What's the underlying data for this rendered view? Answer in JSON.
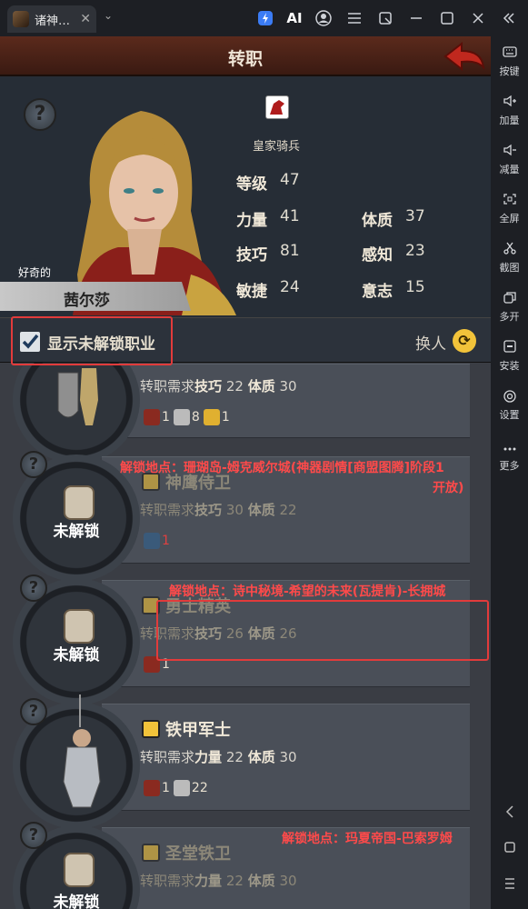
{
  "titlebar": {
    "tab_title": "诸神…",
    "tab_close": "✕",
    "dropdown": "⌄",
    "ai_label": "AI"
  },
  "sidebar": [
    {
      "icon": "keyboard-icon",
      "label": "按键"
    },
    {
      "icon": "volume-up-icon",
      "label": "加量"
    },
    {
      "icon": "volume-down-icon",
      "label": "减量"
    },
    {
      "icon": "fullscreen-icon",
      "label": "全屏"
    },
    {
      "icon": "scissors-icon",
      "label": "截图"
    },
    {
      "icon": "multi-window-icon",
      "label": "多开"
    },
    {
      "icon": "apk-icon",
      "label": "安装"
    },
    {
      "icon": "gear-icon",
      "label": "设置"
    },
    {
      "icon": "more-icon",
      "label": "更多"
    }
  ],
  "game": {
    "title": "转职",
    "character": {
      "class_name": "皇家骑兵",
      "mood": "好奇的",
      "name": "茜尔莎",
      "stats": {
        "level_label": "等级",
        "level": "47",
        "str_label": "力量",
        "str": "41",
        "con_label": "体质",
        "con": "37",
        "skill_label": "技巧",
        "skill": "81",
        "per_label": "感知",
        "per": "23",
        "agi_label": "敏捷",
        "agi": "24",
        "will_label": "意志",
        "will": "15"
      }
    },
    "filter": {
      "show_locked_label": "显示未解锁职业",
      "checked": true,
      "swap_label": "换人"
    },
    "locked_label": "未解锁",
    "cards": [
      {
        "req_prefix": "转职需求",
        "req_main_label": "技巧",
        "req_main_val": "22",
        "req_sub_label": "体质",
        "req_sub_val": "30",
        "rewards": [
          {
            "count": "1"
          },
          {
            "count": "8"
          },
          {
            "count": "1"
          }
        ]
      },
      {
        "name": "神鹰侍卫",
        "req_prefix": "转职需求",
        "req_main_label": "技巧",
        "req_main_val": "30",
        "req_sub_label": "体质",
        "req_sub_val": "22",
        "rewards": [
          {
            "count": "1"
          }
        ],
        "note_line1": "解锁地点：珊瑚岛-姆克威尔城(神器剧情[商盟图腾]阶段1",
        "note_line2": "开放)"
      },
      {
        "name": "勇士精英",
        "req_prefix": "转职需求",
        "req_main_label": "技巧",
        "req_main_val": "26",
        "req_sub_label": "体质",
        "req_sub_val": "26",
        "rewards": [
          {
            "count": "1"
          }
        ],
        "note": "解锁地点：诗中秘境-希望的未来(瓦提肯)-长拥城"
      },
      {
        "name": "铁甲军士",
        "req_prefix": "转职需求",
        "req_main_label": "力量",
        "req_main_val": "22",
        "req_sub_label": "体质",
        "req_sub_val": "30",
        "rewards": [
          {
            "count": "1"
          },
          {
            "count": "22"
          }
        ]
      },
      {
        "name": "圣堂铁卫",
        "req_prefix": "转职需求",
        "req_main_label": "力量",
        "req_main_val": "22",
        "req_sub_label": "体质",
        "req_sub_val": "30",
        "note": "解锁地点：玛夏帝国-巴索罗姆"
      }
    ]
  },
  "colors": {
    "accent_gold": "#f2c33a",
    "note_red": "#ff4a4a",
    "highlight_box": "#e23b3b"
  }
}
